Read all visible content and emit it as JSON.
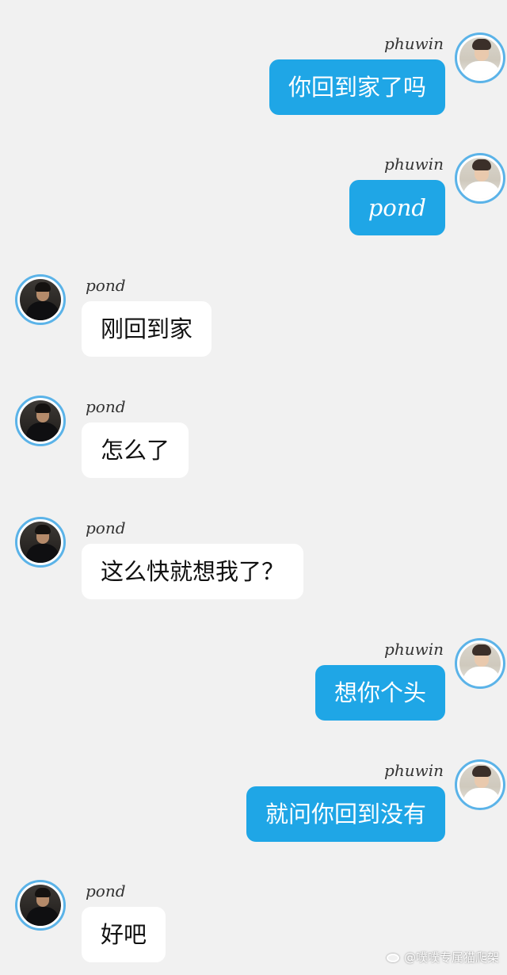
{
  "messages": [
    {
      "side": "out",
      "sender": "phuwin",
      "text": "你回到家了吗"
    },
    {
      "side": "out",
      "sender": "phuwin",
      "text": "pond"
    },
    {
      "side": "in",
      "sender": "pond",
      "text": "刚回到家"
    },
    {
      "side": "in",
      "sender": "pond",
      "text": "怎么了"
    },
    {
      "side": "in",
      "sender": "pond",
      "text": "这么快就想我了？"
    },
    {
      "side": "out",
      "sender": "phuwin",
      "text": "想你个头"
    },
    {
      "side": "out",
      "sender": "phuwin",
      "text": "就问你回到没有"
    },
    {
      "side": "in",
      "sender": "pond",
      "text": "好吧"
    }
  ],
  "watermark": {
    "icon": "weibo-icon",
    "text": "@噗噗专属猫爬架"
  },
  "colors": {
    "background": "#f1f1f1",
    "outgoing_bubble": "#1fa6e6",
    "incoming_bubble": "#ffffff",
    "avatar_border": "#5bb3e8"
  }
}
